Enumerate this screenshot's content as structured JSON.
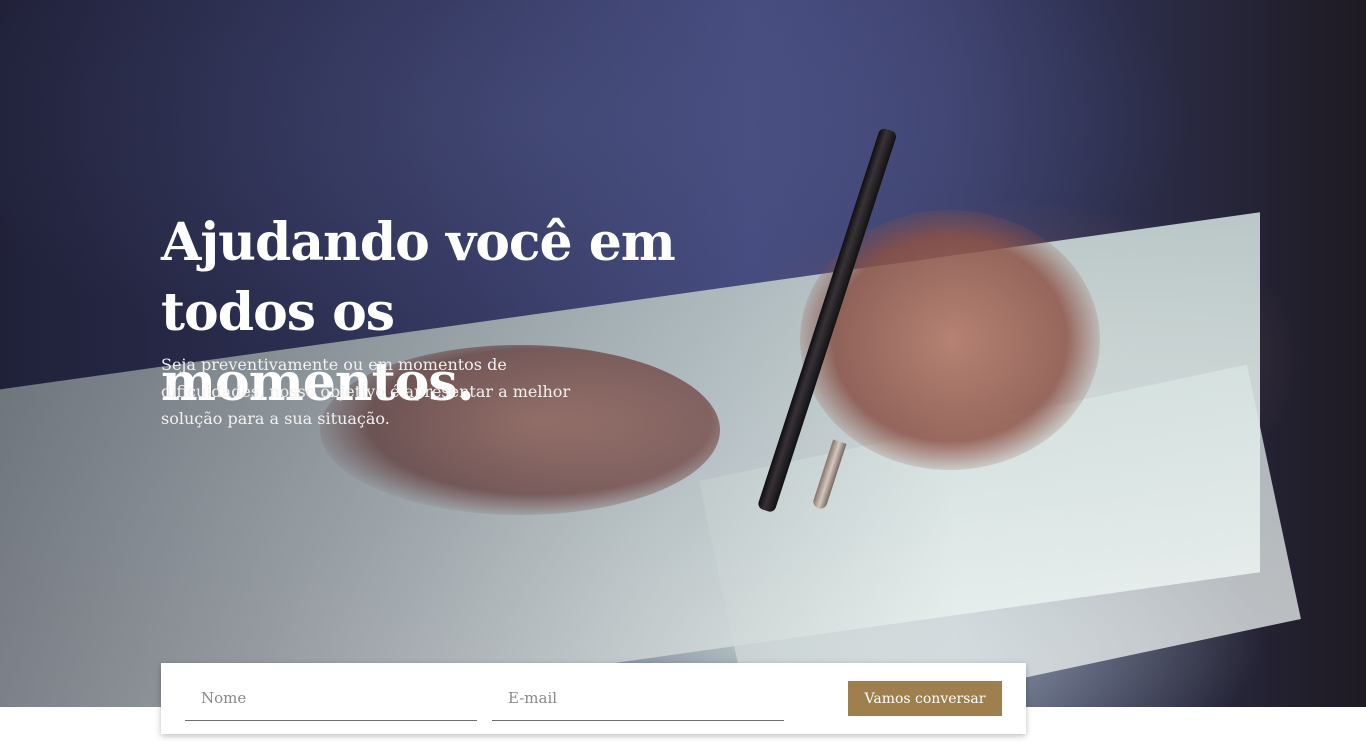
{
  "hero": {
    "headline": "Ajudando você em todos os momentos.",
    "subtitle": "Seja preventivamente ou em momentos de dificuldades, nosso objetivo é apresentar a melhor solução para a sua situação."
  },
  "contact_form": {
    "name_placeholder": "Nome",
    "email_placeholder": "E-mail",
    "submit_label": "Vamos conversar"
  },
  "colors": {
    "accent": "#a07f4e",
    "hero_overlay": "#2c2f4e"
  }
}
